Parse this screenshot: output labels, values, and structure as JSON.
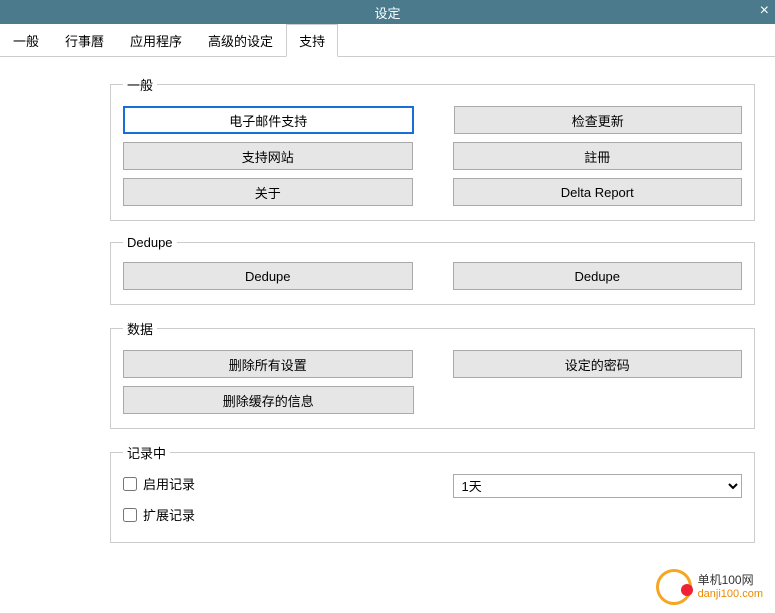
{
  "window": {
    "title": "设定",
    "close": "×"
  },
  "tabs": [
    {
      "label": "一般"
    },
    {
      "label": "行事曆"
    },
    {
      "label": "应用程序"
    },
    {
      "label": "高级的设定"
    },
    {
      "label": "支持",
      "active": true
    }
  ],
  "groups": {
    "general": {
      "legend": "一般",
      "buttons": [
        {
          "label": "电子邮件支持",
          "active": true
        },
        {
          "label": "检查更新"
        },
        {
          "label": "支持网站"
        },
        {
          "label": "註冊"
        },
        {
          "label": "关于"
        },
        {
          "label": "Delta Report"
        }
      ]
    },
    "dedupe": {
      "legend": "Dedupe",
      "buttons": [
        {
          "label": "Dedupe"
        },
        {
          "label": "Dedupe"
        }
      ]
    },
    "data": {
      "legend": "数据",
      "buttons": [
        {
          "label": "删除所有设置"
        },
        {
          "label": "设定的密码"
        },
        {
          "label": "删除缓存的信息"
        }
      ]
    },
    "record": {
      "legend": "记录中",
      "enable_label": "启用记录",
      "extend_label": "扩展记录",
      "dropdown_value": "1天"
    }
  },
  "watermark": {
    "line1": "单机100网",
    "line2": "danji100.com"
  }
}
